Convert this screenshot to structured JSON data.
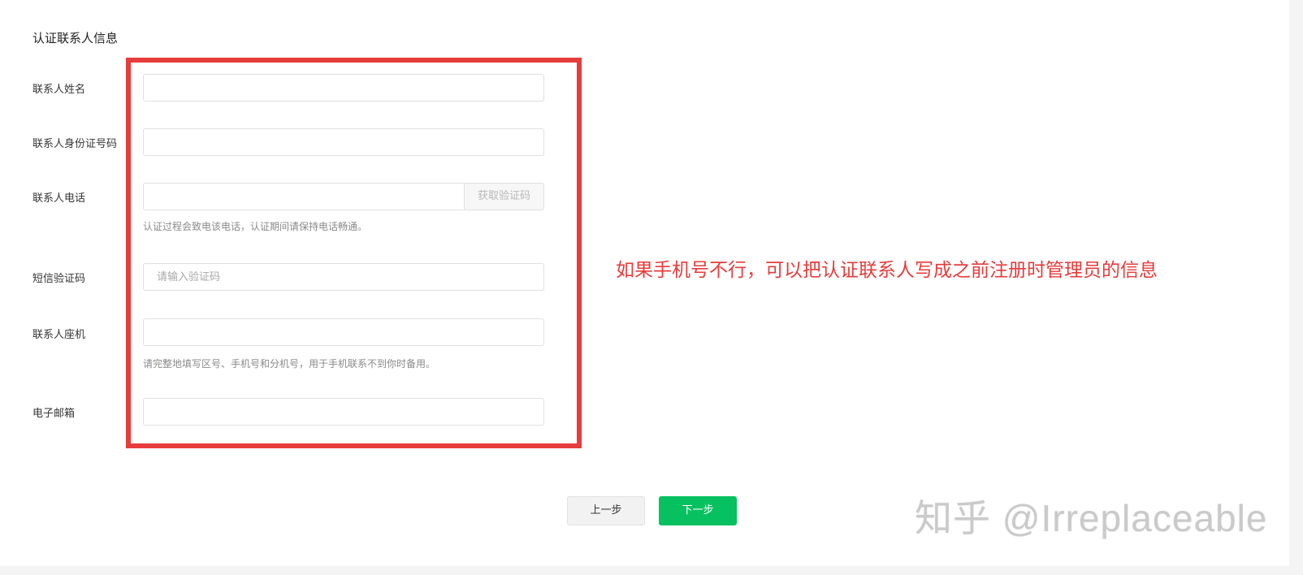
{
  "section": {
    "title": "认证联系人信息"
  },
  "fields": {
    "name_label": "联系人姓名",
    "id_label": "联系人身份证号码",
    "phone_label": "联系人电话",
    "get_code_button": "获取验证码",
    "phone_hint": "认证过程会致电该电话，认证期间请保持电话畅通。",
    "sms_label": "短信验证码",
    "sms_placeholder": "请输入验证码",
    "landline_label": "联系人座机",
    "landline_hint": "请完整地填写区号、手机号和分机号，用于手机联系不到你时备用。",
    "email_label": "电子邮箱"
  },
  "annotation": {
    "text": "如果手机号不行，可以把认证联系人写成之前注册时管理员的信息",
    "color": "#e63c3c"
  },
  "buttons": {
    "prev_label": "上一步",
    "next_label": "下一步",
    "next_color": "#07c160"
  },
  "watermark": {
    "text": "知乎 @Irreplaceable"
  }
}
